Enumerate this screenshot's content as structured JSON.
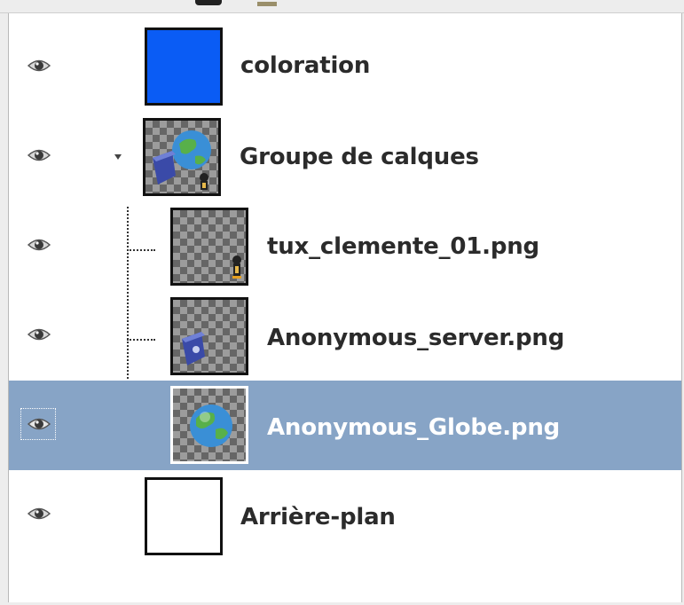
{
  "colors": {
    "selection": "#87a4c6",
    "coloration_fill": "#0a5cf5",
    "panel_bg": "#ffffff"
  },
  "layers": [
    {
      "name": "coloration",
      "visible": true,
      "thumbnail": "solid-blue",
      "level": 0
    },
    {
      "name": "Groupe de calques",
      "visible": true,
      "thumbnail": "group",
      "level": 0,
      "expanded": true
    },
    {
      "name": "tux_clemente_01.png",
      "visible": true,
      "thumbnail": "tux",
      "level": 1
    },
    {
      "name": "Anonymous_server.png",
      "visible": true,
      "thumbnail": "server",
      "level": 1
    },
    {
      "name": "Anonymous_Globe.png",
      "visible": true,
      "thumbnail": "globe",
      "level": 1,
      "selected": true
    },
    {
      "name": "Arrière-plan",
      "visible": true,
      "thumbnail": "white",
      "level": 0
    }
  ],
  "icons": {
    "visibility": "eye-icon",
    "expander": "triangle-down-icon"
  }
}
